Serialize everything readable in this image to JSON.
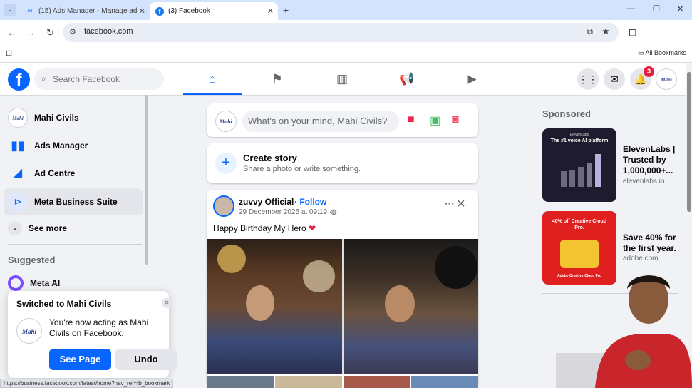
{
  "browser": {
    "tabs": [
      {
        "title": "(15) Ads Manager - Manage ad",
        "active": false
      },
      {
        "title": "(3) Facebook",
        "active": true
      }
    ],
    "url": "facebook.com",
    "all_bookmarks": "All Bookmarks",
    "status_url": "https://business.facebook.com/latest/home?nav_ref=fb_bookmark"
  },
  "header": {
    "search_placeholder": "Search Facebook",
    "notifications_count": "3"
  },
  "sidebar": {
    "items": [
      {
        "label": "Mahi Civils"
      },
      {
        "label": "Ads Manager"
      },
      {
        "label": "Ad Centre"
      },
      {
        "label": "Meta Business Suite"
      }
    ],
    "see_more": "See more",
    "suggested_heading": "Suggested",
    "suggested_items": [
      {
        "label": "Meta AI"
      }
    ]
  },
  "toast": {
    "title": "Switched to Mahi Civils",
    "message": "You're now acting as Mahi Civils on Facebook.",
    "primary_button": "See Page",
    "secondary_button": "Undo"
  },
  "composer": {
    "placeholder": "What's on your mind, Mahi Civils?"
  },
  "story": {
    "title": "Create story",
    "subtitle": "Share a photo or write something."
  },
  "post": {
    "author": "zuvvy Official",
    "follow_label": "· Follow",
    "date": "29 December 2025 at 09:19 ·",
    "text": "Happy Birthday My Hero",
    "emoji": "❤"
  },
  "sponsored": {
    "heading": "Sponsored",
    "ads": [
      {
        "title": "ElevenLabs | Trusted by 1,000,000+...",
        "domain": "elevenlabs.io",
        "image_text": "The #1 voice AI platform",
        "brand": "ElevenLabs"
      },
      {
        "title": "Save 40% for the first year.",
        "domain": "adobe.com",
        "image_text": "40% off Creative Cloud Pro.",
        "brand": "Adobe Creative Cloud Pro"
      }
    ]
  },
  "colors": {
    "fb_blue": "#0866ff",
    "browser_tab_bg": "#d3e3fd",
    "page_bg": "#f0f2f5",
    "badge_red": "#e41e3f"
  }
}
